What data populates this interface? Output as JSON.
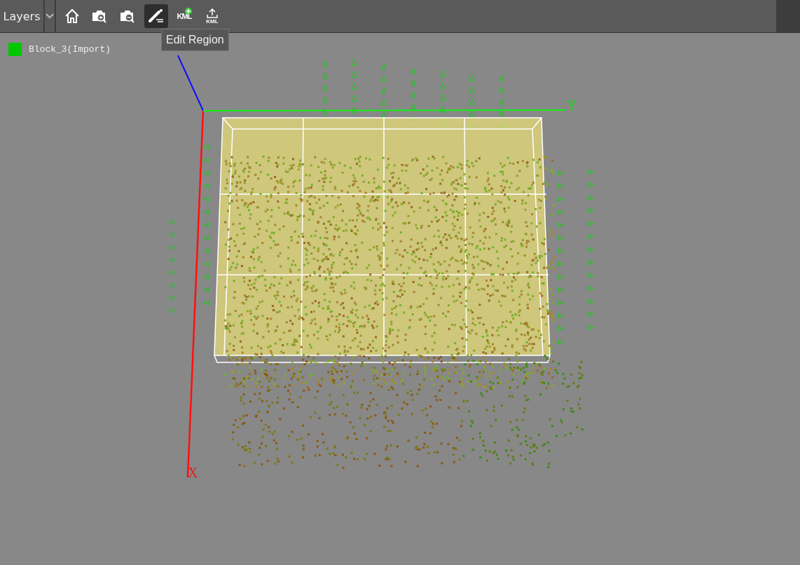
{
  "toolbar": {
    "layers_label": "Layers",
    "tools": [
      {
        "kind": "home",
        "selected": false
      },
      {
        "kind": "zoom-in",
        "selected": false
      },
      {
        "kind": "zoom-out",
        "selected": false
      },
      {
        "kind": "edit",
        "selected": true
      },
      {
        "kind": "kml-add",
        "text": "KML",
        "selected": false
      },
      {
        "kind": "kml-export",
        "text": "KML",
        "selected": false
      }
    ]
  },
  "tooltip": "Edit Region",
  "legend": {
    "label": "Block_3(Import)",
    "color": "#00c800"
  },
  "axes": {
    "x_label": "X",
    "y_label": "Y"
  }
}
